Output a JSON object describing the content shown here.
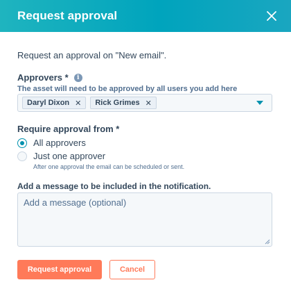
{
  "dialog": {
    "title": "Request approval",
    "intro": "Request an approval on \"New email\".",
    "approvers": {
      "label": "Approvers *",
      "help": "The asset will need to be approved by all users you add here",
      "chips": [
        "Daryl Dixon",
        "Rick Grimes"
      ]
    },
    "require": {
      "label": "Require approval from *",
      "options": [
        {
          "label": "All approvers",
          "sub": "",
          "checked": true
        },
        {
          "label": "Just one approver",
          "sub": "After one approval the email can be scheduled or sent.",
          "checked": false
        }
      ]
    },
    "message": {
      "label": "Add a message to be included in the notification.",
      "placeholder": "Add a message (optional)",
      "value": ""
    },
    "buttons": {
      "primary": "Request approval",
      "secondary": "Cancel"
    }
  },
  "icons": {
    "close": "close-icon",
    "info": "info-icon",
    "chip_remove": "close-icon",
    "dropdown": "chevron-down-icon"
  },
  "colors": {
    "header": "#00a4bd",
    "accent": "#0091ae",
    "primary_button": "#ff7a59",
    "text": "#33475b"
  }
}
